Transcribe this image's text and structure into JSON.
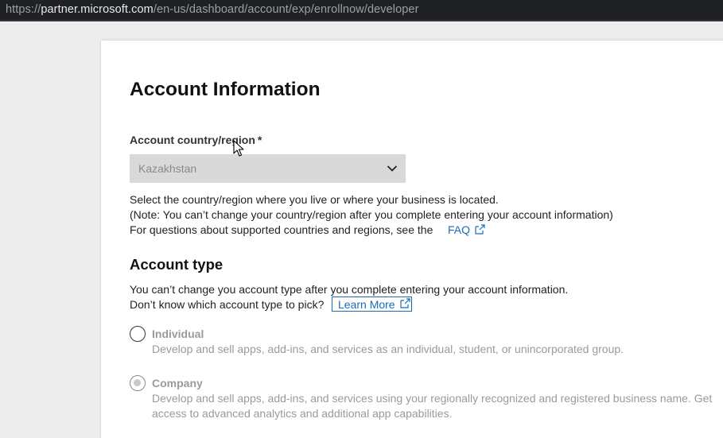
{
  "browser": {
    "url_scheme": "https://",
    "url_host": "partner.microsoft.com",
    "url_path": "/en-us/dashboard/account/exp/enrollnow/developer"
  },
  "page": {
    "title": "Account Information"
  },
  "country": {
    "label": "Account country/region",
    "required_marker": "*",
    "selected_value": "Kazakhstan",
    "help_line1": "Select the country/region where you live or where your business is located.",
    "help_line2": "(Note: You can’t change your country/region after you complete entering your account information)",
    "help_line3": "For questions about supported countries and regions, see the",
    "faq_link": "FAQ"
  },
  "account_type": {
    "heading": "Account type",
    "note_line1": "You can’t change you account type after you complete entering your account information.",
    "note_line2": "Don’t know which account type to pick?",
    "learn_more": "Learn More",
    "options": [
      {
        "title": "Individual",
        "description": "Develop and sell apps, add-ins, and services as an individual, student, or unincorporated group.",
        "selected": false
      },
      {
        "title": "Company",
        "description_line1": "Develop and sell apps, add-ins, and services using your regionally recognized and registered business name. Get",
        "description_line2": "access to advanced analytics and additional app capabilities.",
        "selected": true
      }
    ]
  },
  "colors": {
    "link": "#1a6bb8",
    "select_bg": "#d9d9d9",
    "disabled_text": "#9a9a9a"
  },
  "icons": [
    "chevron-down-icon",
    "external-link-icon",
    "mouse-cursor-icon"
  ]
}
